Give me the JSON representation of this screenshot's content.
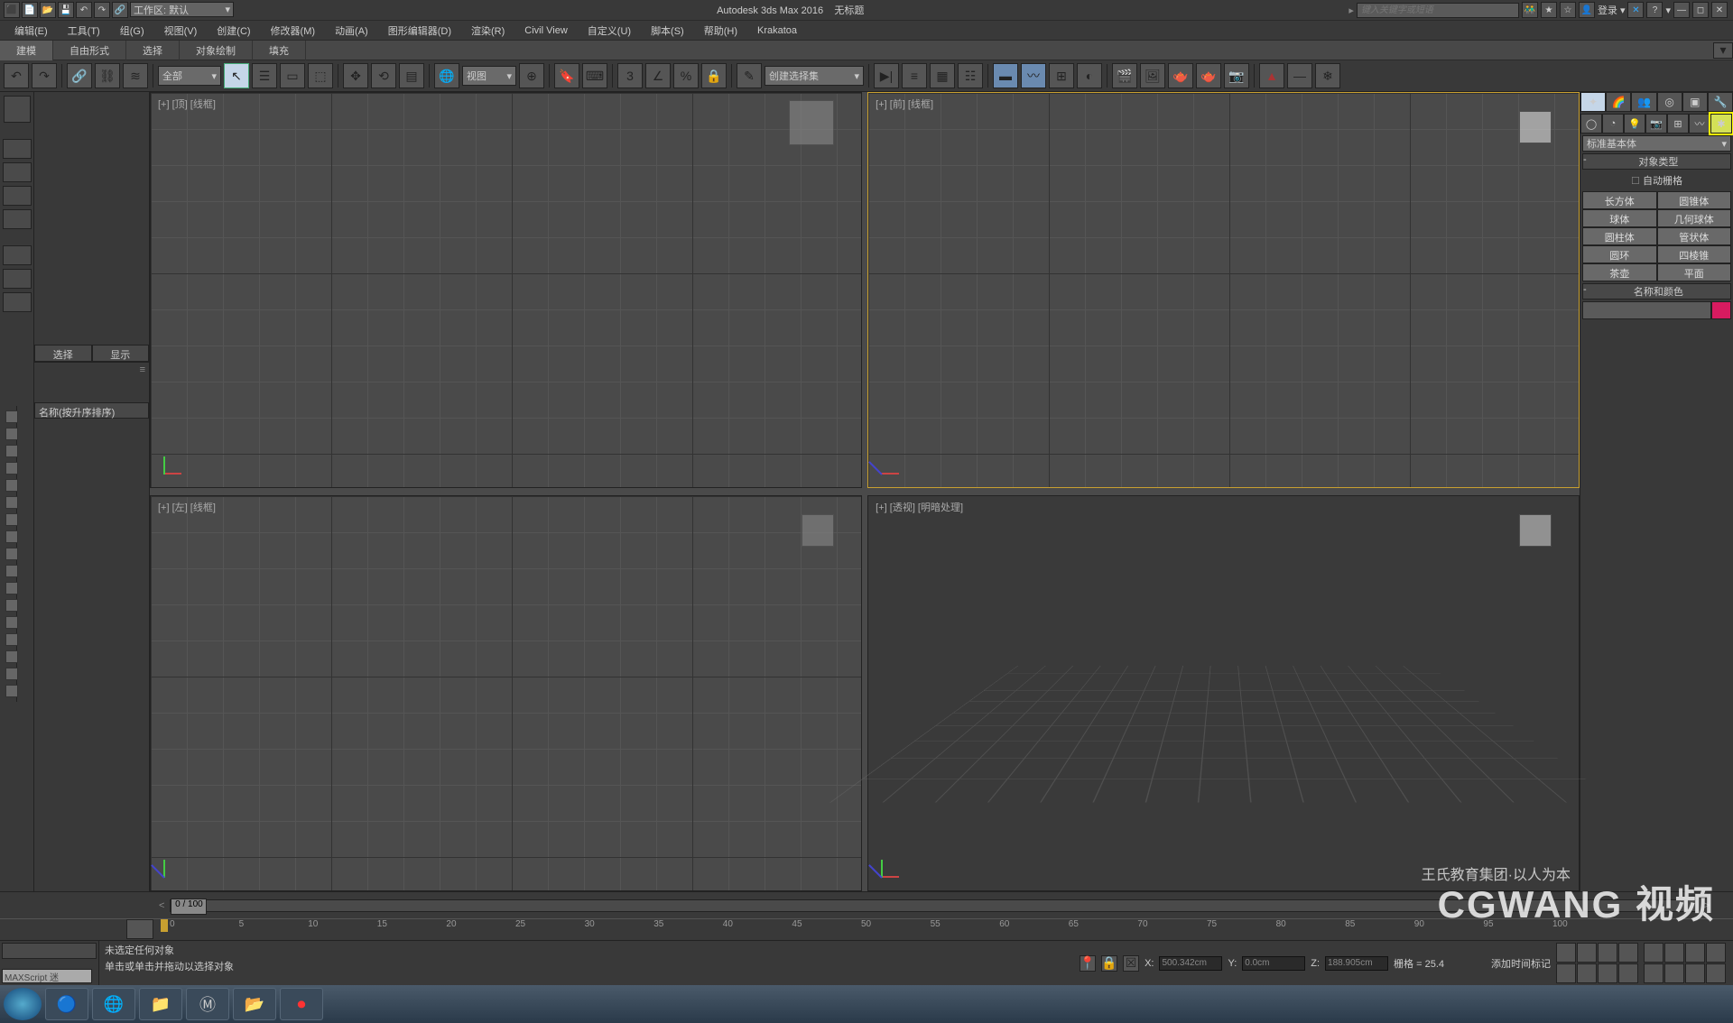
{
  "title": {
    "app": "Autodesk 3ds Max 2016",
    "doc": "无标题"
  },
  "workspace": "工作区: 默认",
  "search_ph": "键入关键字或短语",
  "login": "登录",
  "menu": [
    "编辑(E)",
    "工具(T)",
    "组(G)",
    "视图(V)",
    "创建(C)",
    "修改器(M)",
    "动画(A)",
    "图形编辑器(D)",
    "渲染(R)",
    "Civil View",
    "自定义(U)",
    "脚本(S)",
    "帮助(H)",
    "Krakatoa"
  ],
  "ribbon": {
    "tabs": [
      "建模",
      "自由形式",
      "选择",
      "对象绘制",
      "填充"
    ]
  },
  "toolbar": {
    "sel_filter": "全部",
    "view_mode": "视图",
    "named_sel": "创建选择集"
  },
  "scene": {
    "tab1": "选择",
    "tab2": "显示",
    "header": "名称(按升序排序)"
  },
  "viewports": {
    "tl": "[+] [顶] [线框]",
    "tr": "[+] [前] [线框]",
    "bl": "[+] [左] [线框]",
    "br": "[+] [透视] [明暗处理]"
  },
  "cmd": {
    "dropdown": "标准基本体",
    "rollout1": "对象类型",
    "autogrid": "自动栅格",
    "objects": [
      "长方体",
      "圆锥体",
      "球体",
      "几何球体",
      "圆柱体",
      "管状体",
      "圆环",
      "四棱锥",
      "茶壶",
      "平面"
    ],
    "rollout2": "名称和颜色"
  },
  "timeline": {
    "frame": "0 / 100",
    "ticks": [
      0,
      5,
      10,
      15,
      20,
      25,
      30,
      35,
      40,
      45,
      50,
      55,
      60,
      65,
      70,
      75,
      80,
      85,
      90,
      95,
      100
    ]
  },
  "status": {
    "msx": "MAXScript 迷",
    "line1": "未选定任何对象",
    "line2": "单击或单击并拖动以选择对象",
    "x": "500.342cm",
    "y": "0.0cm",
    "z": "188.905cm",
    "grid": "栅格 = 25.4",
    "addtime": "添加时间标记"
  },
  "watermark": {
    "main": "CGWANG 视频",
    "sub": "王氏教育集团·以人为本"
  }
}
